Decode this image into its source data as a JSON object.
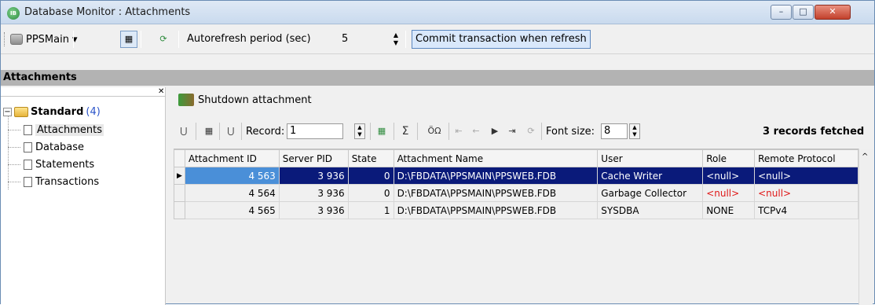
{
  "window": {
    "title": "Database Monitor : Attachments",
    "min": "–",
    "max": "□",
    "close": "✕"
  },
  "toolbar": {
    "database": "PPSMain",
    "dropdown": "▾",
    "autorefresh_label": "Autorefresh period (sec)",
    "autorefresh_value": "5",
    "commit_label": "Commit transaction when refresh"
  },
  "section": {
    "title": "Attachments"
  },
  "tree": {
    "root_label": "Standard",
    "root_count": "(4)",
    "expander": "−",
    "items": [
      "Attachments",
      "Database",
      "Statements",
      "Transactions"
    ]
  },
  "actions": {
    "shutdown": "Shutdown attachment"
  },
  "gridbar": {
    "record_label": "Record:",
    "record_value": "1",
    "sigma": "Σ",
    "font_label": "Font size:",
    "font_value": "8",
    "fetched": "3 records fetched"
  },
  "grid": {
    "columns": [
      "Attachment ID",
      "Server PID",
      "State",
      "Attachment Name",
      "User",
      "Role",
      "Remote Protocol"
    ],
    "rows": [
      {
        "id": "4 563",
        "pid": "3 936",
        "state": "0",
        "name": "D:\\FBDATA\\PPSMAIN\\PPSWEB.FDB",
        "user": "Cache Writer",
        "role": "<null>",
        "protocol": "<null>"
      },
      {
        "id": "4 564",
        "pid": "3 936",
        "state": "0",
        "name": "D:\\FBDATA\\PPSMAIN\\PPSWEB.FDB",
        "user": "Garbage Collector",
        "role": "<null>",
        "protocol": "<null>"
      },
      {
        "id": "4 565",
        "pid": "3 936",
        "state": "1",
        "name": "D:\\FBDATA\\PPSMAIN\\PPSWEB.FDB",
        "user": "SYSDBA",
        "role": "NONE",
        "protocol": "TCPv4"
      }
    ],
    "row_indicator": "▶"
  },
  "colors": {
    "selection": "#0a1a7a",
    "null_text": "#e01818",
    "header_band": "#b3b3b3"
  }
}
